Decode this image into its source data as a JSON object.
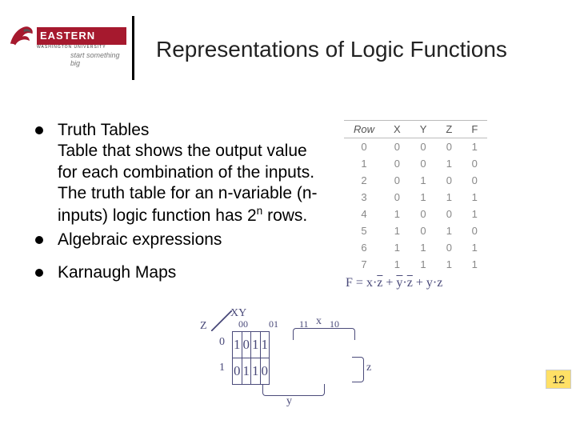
{
  "logo": {
    "main": "EASTERN",
    "sub": "WASHINGTON UNIVERSITY",
    "tag": "start something big"
  },
  "title": "Representations of Logic Functions",
  "bullets": {
    "b1_title": "Truth Tables",
    "b1_body": "Table that shows the output value for each combination of the inputs. The truth table for an n-variable (n-inputs) logic function has 2",
    "b1_exp": "n",
    "b1_tail": " rows.",
    "b2": "Algebraic expressions",
    "b3": "Karnaugh Maps"
  },
  "algebraic": {
    "F": "F",
    "eq": "=",
    "t1a": "x",
    "t1b": "z",
    "plus": "+",
    "t2a": "y",
    "t2b": "z",
    "t3a": "y",
    "t3b": "z"
  },
  "truth": {
    "headers": [
      "Row",
      "X",
      "Y",
      "Z",
      "F"
    ],
    "rows": [
      [
        "0",
        "0",
        "0",
        "0",
        "1"
      ],
      [
        "1",
        "0",
        "0",
        "1",
        "0"
      ],
      [
        "2",
        "0",
        "1",
        "0",
        "0"
      ],
      [
        "3",
        "0",
        "1",
        "1",
        "1"
      ],
      [
        "4",
        "1",
        "0",
        "0",
        "1"
      ],
      [
        "5",
        "1",
        "0",
        "1",
        "0"
      ],
      [
        "6",
        "1",
        "1",
        "0",
        "1"
      ],
      [
        "7",
        "1",
        "1",
        "1",
        "1"
      ]
    ]
  },
  "kmap": {
    "xy": "XY",
    "z": "Z",
    "col": [
      "00",
      "01",
      "11",
      "10"
    ],
    "row": [
      "0",
      "1"
    ],
    "cells": [
      [
        "1",
        "0",
        "1",
        "1"
      ],
      [
        "0",
        "1",
        "1",
        "0"
      ]
    ],
    "gx": "x",
    "gy": "y",
    "gz": "z"
  },
  "page": "12",
  "chart_data": {
    "type": "table",
    "title": "Truth table for F(X,Y,Z)",
    "columns": [
      "Row",
      "X",
      "Y",
      "Z",
      "F"
    ],
    "rows": [
      [
        0,
        0,
        0,
        0,
        1
      ],
      [
        1,
        0,
        0,
        1,
        0
      ],
      [
        2,
        0,
        1,
        0,
        0
      ],
      [
        3,
        0,
        1,
        1,
        1
      ],
      [
        4,
        1,
        0,
        0,
        1
      ],
      [
        5,
        1,
        0,
        1,
        0
      ],
      [
        6,
        1,
        1,
        0,
        1
      ],
      [
        7,
        1,
        1,
        1,
        1
      ]
    ],
    "kmap": {
      "row_var": "Z",
      "col_vars": "XY",
      "col_order": [
        "00",
        "01",
        "11",
        "10"
      ],
      "row_order": [
        "0",
        "1"
      ],
      "grid": [
        [
          1,
          0,
          1,
          1
        ],
        [
          0,
          1,
          1,
          0
        ]
      ]
    },
    "expression": "F = x·z' + y'·z' + y·z"
  }
}
